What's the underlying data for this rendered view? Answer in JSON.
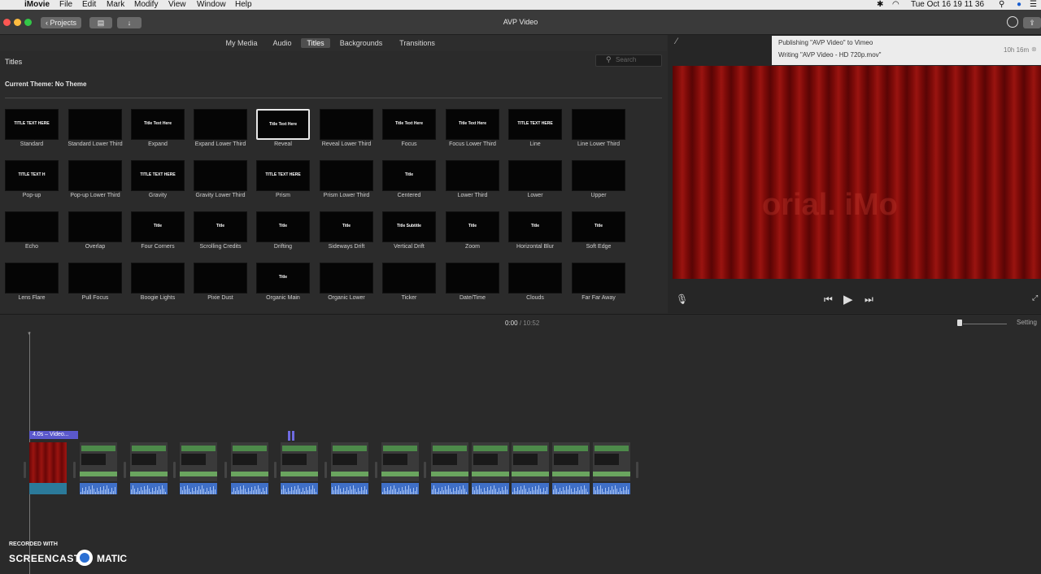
{
  "menubar": {
    "apple": "",
    "items": [
      "iMovie",
      "File",
      "Edit",
      "Mark",
      "Modify",
      "View",
      "Window",
      "Help"
    ],
    "clock": "Tue Oct 16  19 11 36"
  },
  "toolbar": {
    "projects_label": "Projects",
    "window_title": "AVP Video"
  },
  "library_tabs": [
    "My Media",
    "Audio",
    "Titles",
    "Backgrounds",
    "Transitions"
  ],
  "browser": {
    "section_title": "Titles",
    "search_placeholder": "Search",
    "theme_label": "Current Theme: No Theme",
    "tiles": [
      {
        "label": "Standard",
        "text": "TITLE TEXT HERE"
      },
      {
        "label": "Standard Lower Third",
        "text": ""
      },
      {
        "label": "Expand",
        "text": "Title Text Here"
      },
      {
        "label": "Expand Lower Third",
        "text": ""
      },
      {
        "label": "Reveal",
        "text": "Title Text Here"
      },
      {
        "label": "Reveal Lower Third",
        "text": ""
      },
      {
        "label": "Focus",
        "text": "Title Text Here"
      },
      {
        "label": "Focus Lower Third",
        "text": "Title Text Here"
      },
      {
        "label": "Line",
        "text": "TITLE TEXT HERE"
      },
      {
        "label": "Line Lower Third",
        "text": ""
      },
      {
        "label": "Pop-up",
        "text": "TITLE TEXT H"
      },
      {
        "label": "Pop-up Lower Third",
        "text": ""
      },
      {
        "label": "Gravity",
        "text": "TITLE TEXT HERE"
      },
      {
        "label": "Gravity Lower Third",
        "text": ""
      },
      {
        "label": "Prism",
        "text": "TITLE TEXT HERE"
      },
      {
        "label": "Prism Lower Third",
        "text": ""
      },
      {
        "label": "Centered",
        "text": "Title"
      },
      {
        "label": "Lower Third",
        "text": ""
      },
      {
        "label": "Lower",
        "text": ""
      },
      {
        "label": "Upper",
        "text": ""
      },
      {
        "label": "Echo",
        "text": ""
      },
      {
        "label": "Overlap",
        "text": ""
      },
      {
        "label": "Four Corners",
        "text": "Title"
      },
      {
        "label": "Scrolling Credits",
        "text": "Title"
      },
      {
        "label": "Drifting",
        "text": "Title"
      },
      {
        "label": "Sideways Drift",
        "text": "Title"
      },
      {
        "label": "Vertical Drift",
        "text": "Title Subtitle"
      },
      {
        "label": "Zoom",
        "text": "Title"
      },
      {
        "label": "Horizontal Blur",
        "text": "Title"
      },
      {
        "label": "Soft Edge",
        "text": "Title"
      },
      {
        "label": "Lens Flare",
        "text": ""
      },
      {
        "label": "Pull Focus",
        "text": ""
      },
      {
        "label": "Boogie Lights",
        "text": ""
      },
      {
        "label": "Pixie Dust",
        "text": ""
      },
      {
        "label": "Organic Main",
        "text": "Title"
      },
      {
        "label": "Organic Lower",
        "text": ""
      },
      {
        "label": "Ticker",
        "text": ""
      },
      {
        "label": "Date/Time",
        "text": ""
      },
      {
        "label": "Clouds",
        "text": ""
      },
      {
        "label": "Far Far Away",
        "text": ""
      }
    ]
  },
  "notification": {
    "line1": "Publishing \"AVP Video\" to Vimeo",
    "line2": "Writing \"AVP Video - HD 720p.mov\"",
    "eta": "10h 16m"
  },
  "viewer": {
    "ghost_text": "orial. iMo"
  },
  "timeline": {
    "current_time": "0:00",
    "separator": "/",
    "total_time": "10:52",
    "settings_label": "Setting",
    "first_clip_label": "4.0s – Video..."
  },
  "watermark": {
    "recorded_with": "RECORDED WITH",
    "screencast": "SCREENCAST",
    "matic": "MATIC"
  },
  "colors": {
    "accent_purple": "#5b58cc",
    "audio_blue": "#3f6fc7",
    "curtain_red": "#7a0a08"
  }
}
